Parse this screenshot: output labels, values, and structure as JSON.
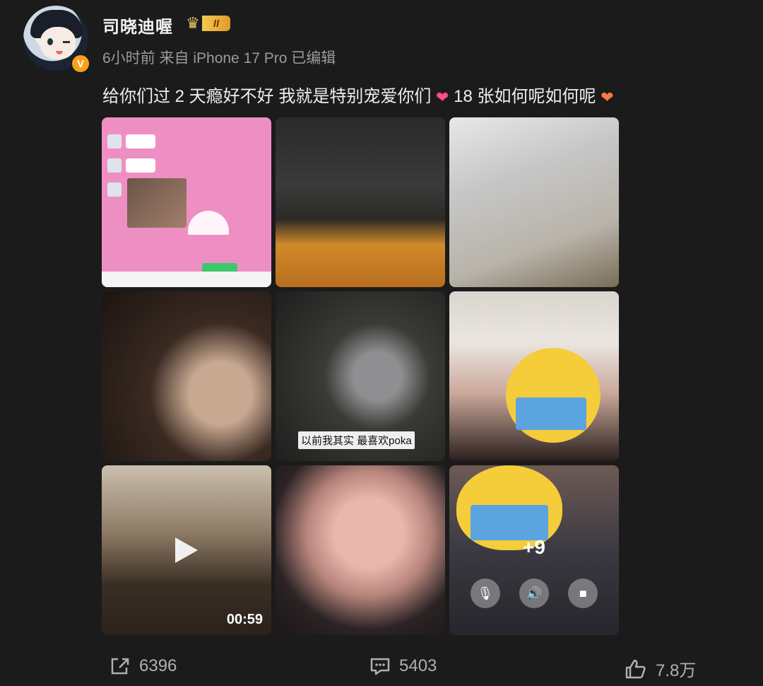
{
  "post": {
    "username": "司晓迪喔",
    "level": "II",
    "verified_badge": "V",
    "meta": "6小时前  来自 iPhone 17 Pro 已编辑",
    "text_part1": "给你们过 2 天瘾好不好 我就是特别宠爱你们",
    "text_part2": "18 张如何呢如何呢",
    "heart_colors": [
      "#ff4d86",
      "#ff7a3d"
    ]
  },
  "grid": {
    "cell5_caption": "以前我其实 最喜欢poka",
    "cell7_duration": "00:59",
    "cell9_more": "+9"
  },
  "actions": {
    "share_count": "6396",
    "comment_count": "5403",
    "like_count": "7.8万"
  }
}
